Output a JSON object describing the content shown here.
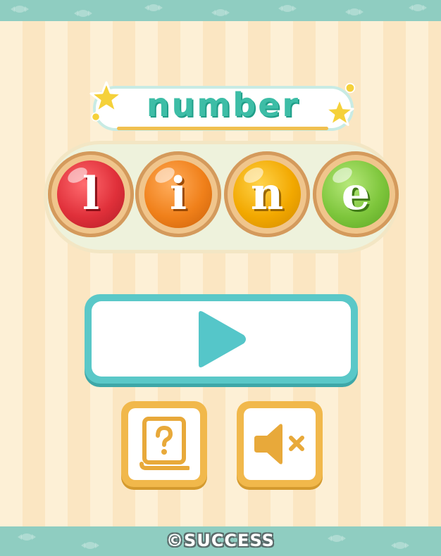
{
  "title": {
    "word1": "number",
    "word2_letters": [
      {
        "char": "l",
        "color": "#e0303a",
        "label": "letter-l"
      },
      {
        "char": "i",
        "color": "#f0801a",
        "label": "letter-i"
      },
      {
        "char": "n",
        "color": "#f2a800",
        "label": "letter-n"
      },
      {
        "char": "e",
        "color": "#7ec63c",
        "label": "letter-e"
      }
    ]
  },
  "buttons": {
    "play": {
      "icon": "play-icon",
      "color": "#5ac8c8"
    },
    "help": {
      "icon": "help-book-icon",
      "color": "#f1b84b"
    },
    "sound": {
      "icon": "speaker-muted-icon",
      "color": "#f1b84b"
    }
  },
  "footer": {
    "copyright": "©SUCCESS"
  },
  "colors": {
    "background_stripe_light": "#fdf0d6",
    "background_stripe_dark": "#fbe6c2",
    "band": "#8fcdc1",
    "title_text": "#3dbda6"
  }
}
